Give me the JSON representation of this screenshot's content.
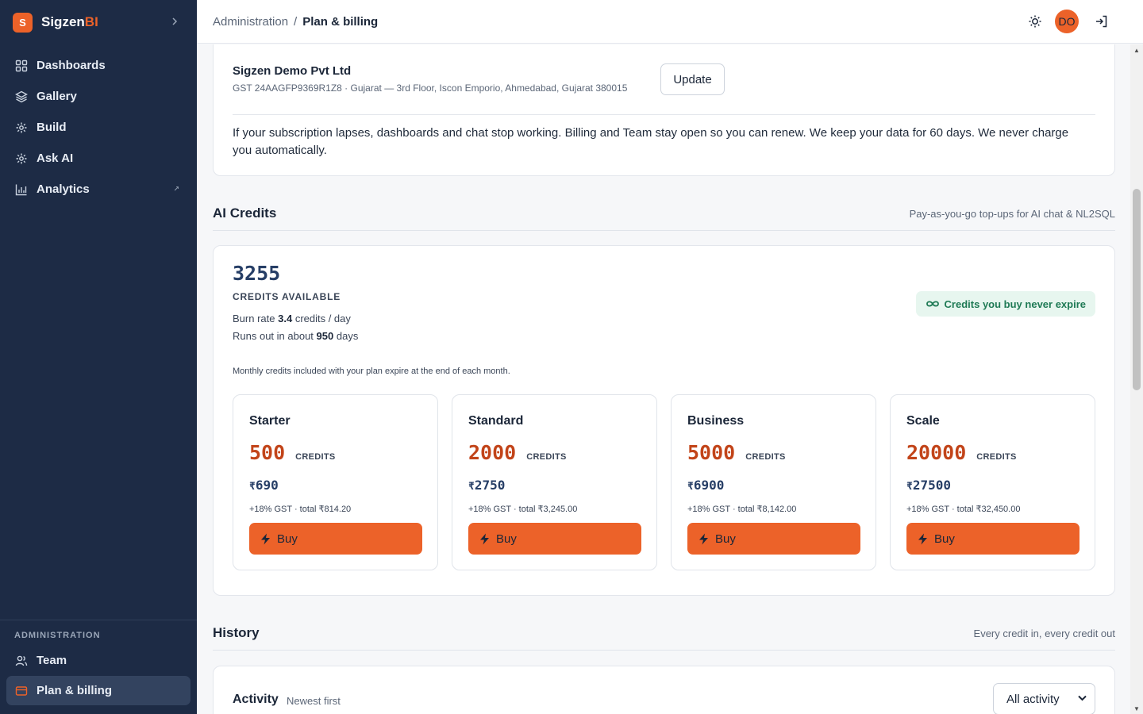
{
  "brand": {
    "logo_letter": "S",
    "name": "Sigzen",
    "name_accent": "BI",
    "colors": {
      "accent": "#ec6229",
      "sidebar": "#1d2b45"
    }
  },
  "sidebar": {
    "items": [
      {
        "label": "Dashboards",
        "icon": "grid-icon"
      },
      {
        "label": "Gallery",
        "icon": "layers-icon"
      },
      {
        "label": "Build",
        "icon": "sparkle-icon"
      },
      {
        "label": "Ask AI",
        "icon": "sparkle-icon"
      },
      {
        "label": "Analytics",
        "icon": "bar-chart-icon",
        "external": "↗"
      }
    ],
    "admin_label": "ADMINISTRATION",
    "admin_items": [
      {
        "label": "Team",
        "icon": "users-icon"
      },
      {
        "label": "Plan & billing",
        "icon": "credit-card-icon",
        "active": true
      }
    ]
  },
  "topbar": {
    "crumb_parent": "Administration",
    "crumb_sep": "/",
    "crumb_current": "Plan & billing",
    "avatar_initials": "DO"
  },
  "company": {
    "name": "Sigzen Demo Pvt Ltd",
    "meta": "GST 24AAGFP9369R1Z8 · Gujarat — 3rd Floor, Iscon Emporio, Ahmedabad, Gujarat 380015",
    "update_label": "Update",
    "lapse_notice": "If your subscription lapses, dashboards and chat stop working. Billing and Team stay open so you can renew. We keep your data for 60 days. We never charge you automatically."
  },
  "credits": {
    "title": "AI Credits",
    "subtitle": "Pay-as-you-go top-ups for AI chat & NL2SQL",
    "balance": "3255",
    "balance_label": "CREDITS AVAILABLE",
    "burn_prefix": "Burn rate",
    "burn_value": "3.4",
    "burn_suffix": "credits / day",
    "runs_prefix": "Runs out in about",
    "runs_value": "950",
    "runs_suffix": "days",
    "never_expire": "Credits you buy never expire",
    "monthly_note": "Monthly credits included with your plan expire at the end of each month.",
    "unit_label": "CREDITS",
    "buy_label": "Buy",
    "currency": "₹",
    "packs": [
      {
        "name": "Starter",
        "amount": "500",
        "price": "690",
        "gst": "+18% GST · total ₹814.20"
      },
      {
        "name": "Standard",
        "amount": "2000",
        "price": "2750",
        "gst": "+18% GST · total ₹3,245.00"
      },
      {
        "name": "Business",
        "amount": "5000",
        "price": "6900",
        "gst": "+18% GST · total ₹8,142.00"
      },
      {
        "name": "Scale",
        "amount": "20000",
        "price": "27500",
        "gst": "+18% GST · total ₹32,450.00"
      }
    ]
  },
  "history": {
    "title": "History",
    "subtitle": "Every credit in, every credit out",
    "activity_title": "Activity",
    "activity_sub": "Newest first",
    "filter_value": "All activity"
  }
}
